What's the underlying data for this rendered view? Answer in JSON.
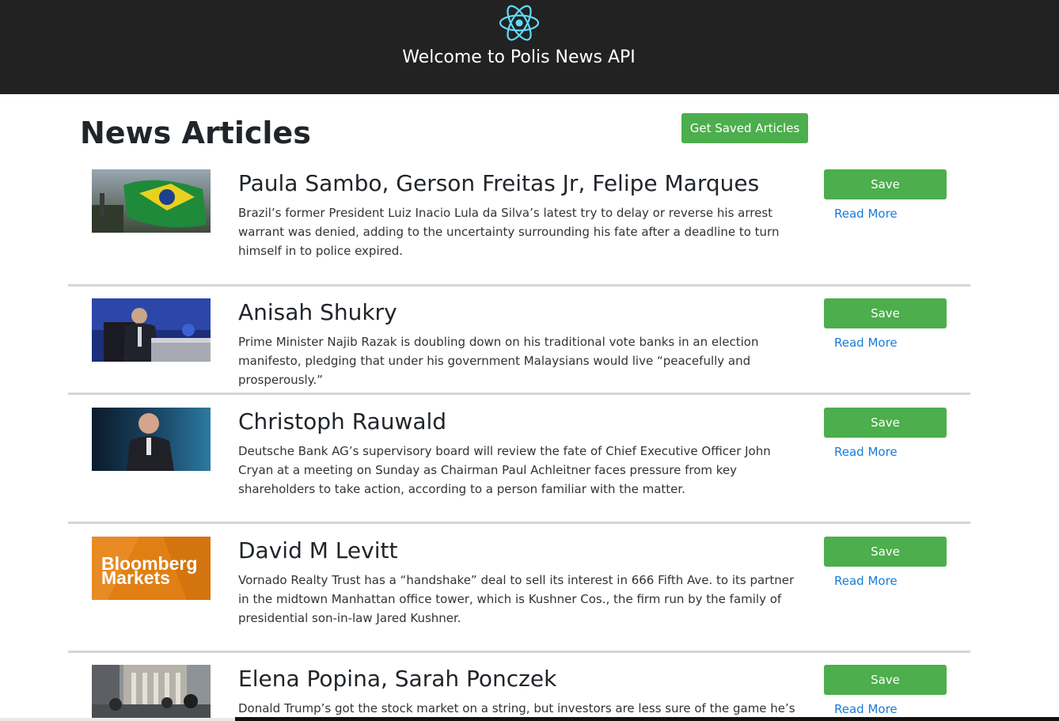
{
  "header": {
    "logo_icon": "react-atom-icon",
    "title": "Welcome to Polis News API",
    "logo_color": "#61dafb",
    "background": "#222222"
  },
  "main": {
    "title": "News Articles",
    "get_saved_label": "Get Saved Articles"
  },
  "articles": [
    {
      "author": "Paula Sambo, Gerson Freitas Jr, Felipe Marques",
      "description": "Brazil’s former President Luiz Inacio Lula da Silva’s latest try to delay or reverse his arrest warrant was denied, adding to the uncertainty surrounding his fate after a deadline to turn himself in to police expired.",
      "save_label": "Save",
      "read_more_label": "Read More",
      "image": "brazil-flag-thumbnail"
    },
    {
      "author": "Anisah Shukry",
      "description": "Prime Minister Najib Razak is doubling down on his traditional vote banks in an election manifesto, pledging that under his government Malaysians would live “peacefully and prosperously.”",
      "save_label": "Save",
      "read_more_label": "Read More",
      "image": "speaker-at-podium-thumbnail"
    },
    {
      "author": "Christoph Rauwald",
      "description": "Deutsche Bank AG’s supervisory board will review the fate of Chief Executive Officer John Cryan at a meeting on Sunday as Chairman Paul Achleitner faces pressure from key shareholders to take action, according to a person familiar with the matter.",
      "save_label": "Save",
      "read_more_label": "Read More",
      "image": "executive-portrait-thumbnail"
    },
    {
      "author": "David M Levitt",
      "description": "Vornado Realty Trust has a “handshake” deal to sell its interest in 666 Fifth Ave. to its partner in the midtown Manhattan office tower, which is Kushner Cos., the firm run by the family of presidential son-in-law Jared Kushner.",
      "save_label": "Save",
      "read_more_label": "Read More",
      "image": "bloomberg-markets-logo-thumbnail",
      "image_text_line1": "Bloomberg",
      "image_text_line2": "Markets"
    },
    {
      "author": "Elena Popina, Sarah Ponczek",
      "description": "Donald Trump’s got the stock market on a string, but investors are less sure of the game he’s",
      "save_label": "Save",
      "read_more_label": "Read More",
      "image": "stock-exchange-street-thumbnail"
    }
  ],
  "colors": {
    "button_green": "#4cae4c",
    "link_blue": "#1a7bd8"
  }
}
